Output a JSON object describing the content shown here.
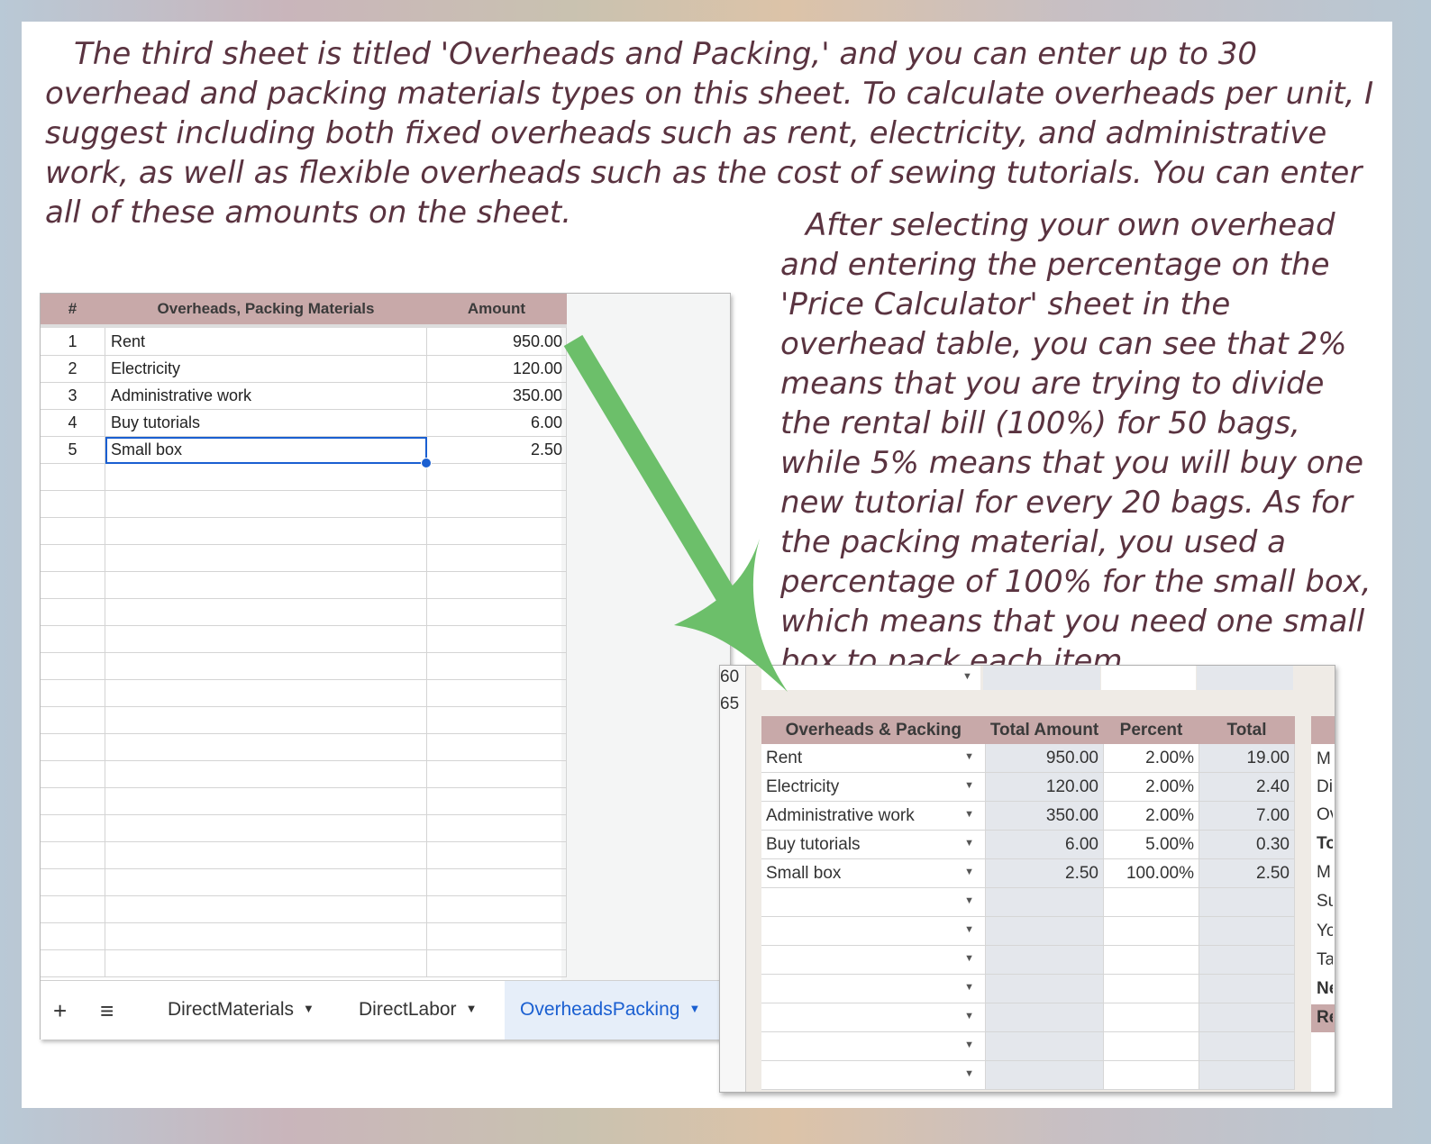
{
  "intro_text": "The third sheet is titled 'Overheads and Packing,' and you can enter up to 30 overhead and packing materials types on this sheet. To calculate overheads per unit, I suggest including both fixed overheads such as rent, electricity, and administrative work, as well as flexible overheads such as the cost of sewing tutorials. You can enter all of these amounts on the sheet.",
  "explanation_text": "After selecting your own overhead and entering the percentage on the 'Price Calculator' sheet in the overhead table, you can see that 2% means that you are trying to divide the rental bill (100%) for 50 bags, while 5% means that you will buy one new tutorial for every 20 bags. As for the packing material, you used a percentage of 100% for the small box, which means that you need one small box to pack each item.",
  "overheads_sheet": {
    "headers": {
      "num": "#",
      "name": "Overheads, Packing Materials",
      "amount": "Amount"
    },
    "rows": [
      {
        "num": "1",
        "name": "Rent",
        "amount": "950.00"
      },
      {
        "num": "2",
        "name": "Electricity",
        "amount": "120.00"
      },
      {
        "num": "3",
        "name": "Administrative work",
        "amount": "350.00"
      },
      {
        "num": "4",
        "name": "Buy tutorials",
        "amount": "6.00"
      },
      {
        "num": "5",
        "name": "Small box",
        "amount": "2.50"
      }
    ],
    "tabs": {
      "add_icon": "+",
      "menu_icon": "≡",
      "items": [
        "DirectMaterials",
        "DirectLabor",
        "OverheadsPacking"
      ],
      "active": "OverheadsPacking"
    }
  },
  "price_calculator": {
    "row_numbers": [
      "60",
      "65"
    ],
    "headers": {
      "label": "Overheads & Packing",
      "total_amount": "Total Amount",
      "percent": "Percent",
      "total": "Total"
    },
    "rows": [
      {
        "label": "Rent",
        "total_amount": "950.00",
        "percent": "2.00%",
        "total": "19.00"
      },
      {
        "label": "Electricity",
        "total_amount": "120.00",
        "percent": "2.00%",
        "total": "2.40"
      },
      {
        "label": "Administrative work",
        "total_amount": "350.00",
        "percent": "2.00%",
        "total": "7.00"
      },
      {
        "label": "Buy tutorials",
        "total_amount": "6.00",
        "percent": "5.00%",
        "total": "0.30"
      },
      {
        "label": "Small box",
        "total_amount": "2.50",
        "percent": "100.00%",
        "total": "2.50"
      }
    ],
    "side_labels": [
      "M",
      "Di",
      "Ov",
      "To",
      "M",
      "Su",
      "Yo",
      "Ta",
      "Ne",
      "Re"
    ]
  },
  "colors": {
    "accent_header": "#c8a9a9",
    "arrow": "#6cbf6a",
    "text": "#5a3340",
    "active_tab": "#1a5fd1"
  }
}
